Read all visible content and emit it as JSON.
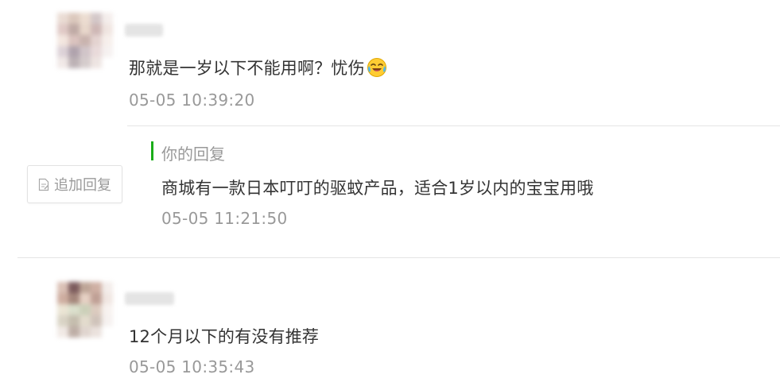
{
  "comments": [
    {
      "text": "那就是一岁以下不能用啊？忧伤",
      "emoji": "laughing-crying-emoji",
      "time": "05-05 10:39:20",
      "reply": {
        "heading": "你的回复",
        "text": "商城有一款日本叮叮的驱蚊产品，适合1岁以内的宝宝用哦",
        "time": "05-05 11:21:50"
      },
      "action": {
        "label": "追加回复",
        "icon": "edit-note-icon"
      }
    },
    {
      "text": "12个月以下的有没有推荐",
      "time": "05-05 10:35:43"
    }
  ],
  "colors": {
    "reply_accent": "#1aad19",
    "time_gray": "#999999",
    "text_dark": "#333333",
    "divider": "#e5e5e5"
  }
}
